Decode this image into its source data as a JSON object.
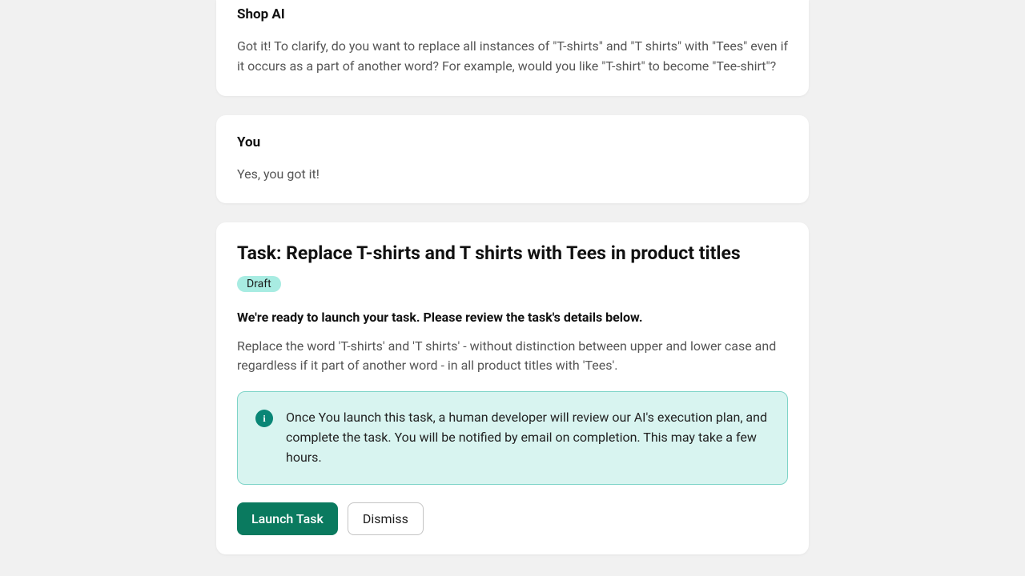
{
  "messages": {
    "ai": {
      "sender": "Shop AI",
      "body": "Got it! To clarify, do you want to replace all instances of \"T-shirts\" and \"T shirts\" with \"Tees\" even if it occurs as a part of another word? For example, would you like \"T-shirt\" to become \"Tee-shirt\"?"
    },
    "user": {
      "sender": "You",
      "body": "Yes, you got it!"
    }
  },
  "task": {
    "title": "Task: Replace T-shirts and T shirts with Tees in product titles",
    "status": "Draft",
    "subtitle": "We're ready to launch your task. Please review the task's details below.",
    "description": "Replace the word 'T-shirts' and 'T shirts' - without distinction between upper and lower case and regardless if it part of another word - in all product titles with 'Tees'.",
    "info": "Once You launch this task, a human developer will review our AI's execution plan, and complete the task. You will be notified by email on completion. This may take a few hours.",
    "buttons": {
      "launch": "Launch Task",
      "dismiss": "Dismiss"
    }
  }
}
